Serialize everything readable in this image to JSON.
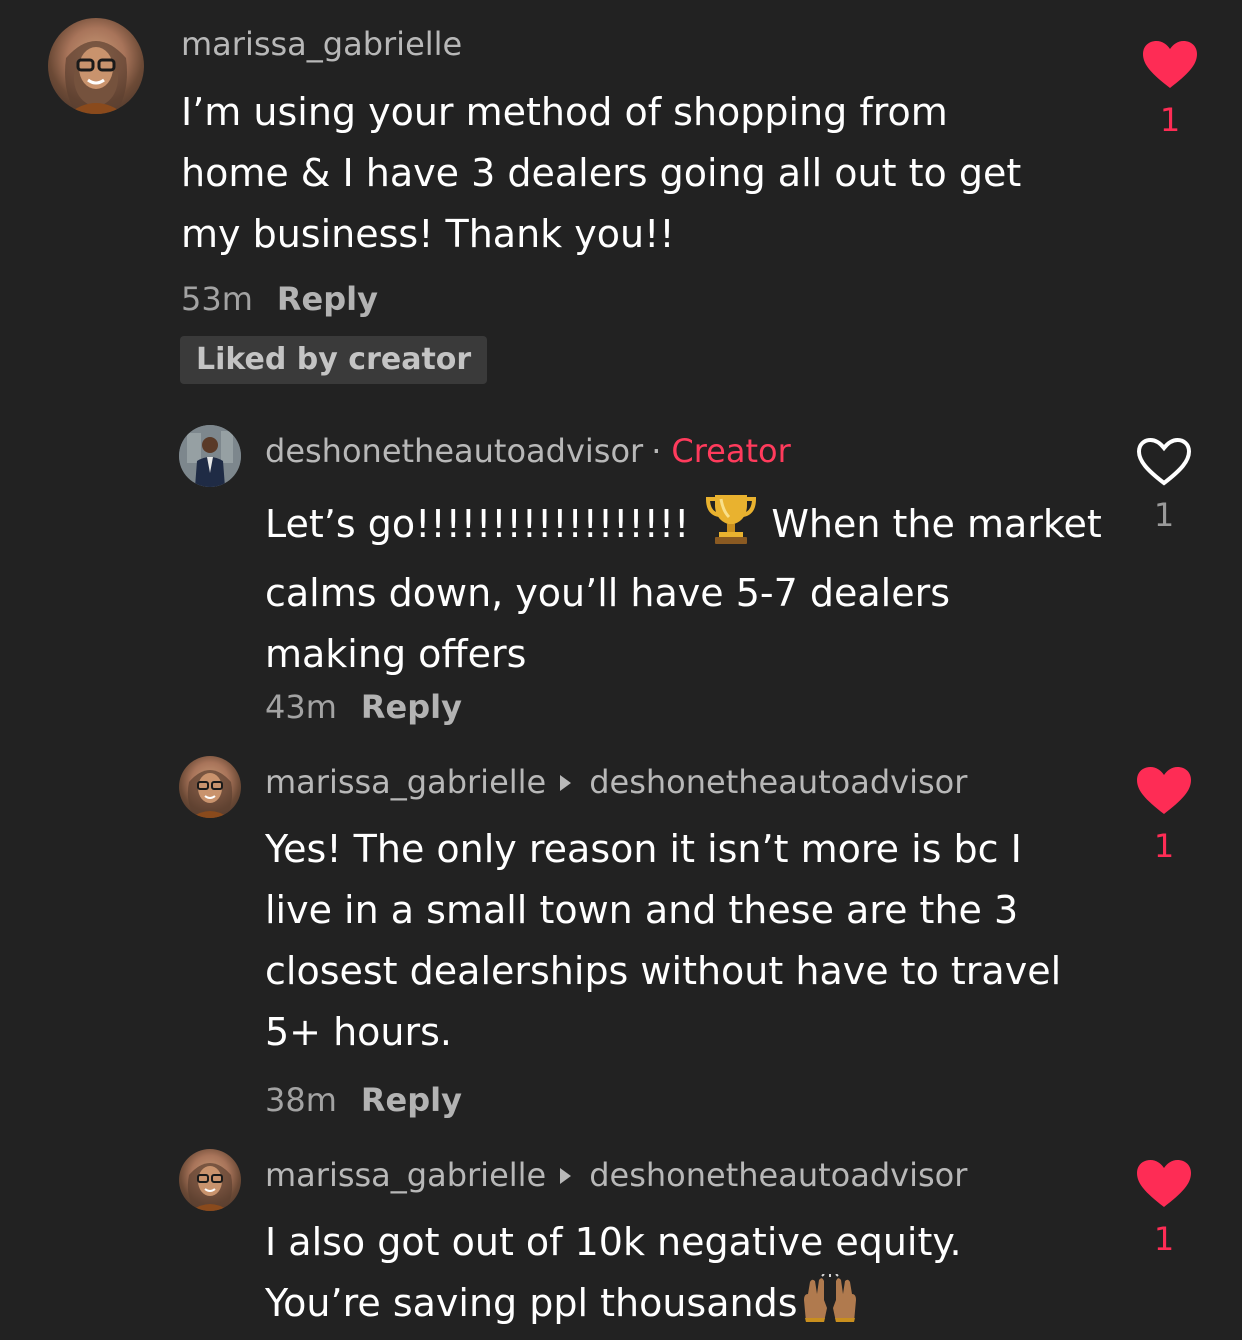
{
  "comments": [
    {
      "username": "marissa_gabrielle",
      "text_lines": [
        "I’m using your method of shopping from",
        "home & I have 3 dealers going all out to get",
        "my business! Thank you!!"
      ],
      "time": "53m",
      "reply_label": "Reply",
      "badge": "Liked by creator",
      "likes": "1",
      "liked": true,
      "avatar_icon": "profile-photo-woman-glasses"
    },
    {
      "username": "deshonetheautoadvisor",
      "separator": "·",
      "creator_label": "Creator",
      "text_line1_before": "Let’s go!!!!!!!!!!!!!!!!!!",
      "text_line1_emoji": "trophy-icon",
      "text_line1_after": "When the market",
      "text_lines_rest": [
        "calms down, you’ll have 5-7 dealers",
        "making offers"
      ],
      "time": "43m",
      "reply_label": "Reply",
      "likes": "1",
      "liked": false,
      "avatar_icon": "profile-photo-man-suit"
    },
    {
      "username": "marissa_gabrielle",
      "reply_to": "deshonetheautoadvisor",
      "text_lines": [
        "Yes! The only reason it isn’t more is bc I",
        "live in a small town and these are the 3",
        "closest dealerships without have to travel",
        "5+ hours."
      ],
      "time": "38m",
      "reply_label": "Reply",
      "likes": "1",
      "liked": true
    },
    {
      "username": "marissa_gabrielle",
      "reply_to": "deshonetheautoadvisor",
      "text_lines": [
        "I also got out of 10k negative equity.",
        "You’re saving ppl thousands"
      ],
      "text_emoji": "raising-hands-icon",
      "likes": "1",
      "liked": true
    }
  ],
  "colors": {
    "background": "#222222",
    "accent_red": "#fe2c55",
    "creator_red": "#ff3b5c",
    "secondary_text": "#b8b8b8"
  }
}
